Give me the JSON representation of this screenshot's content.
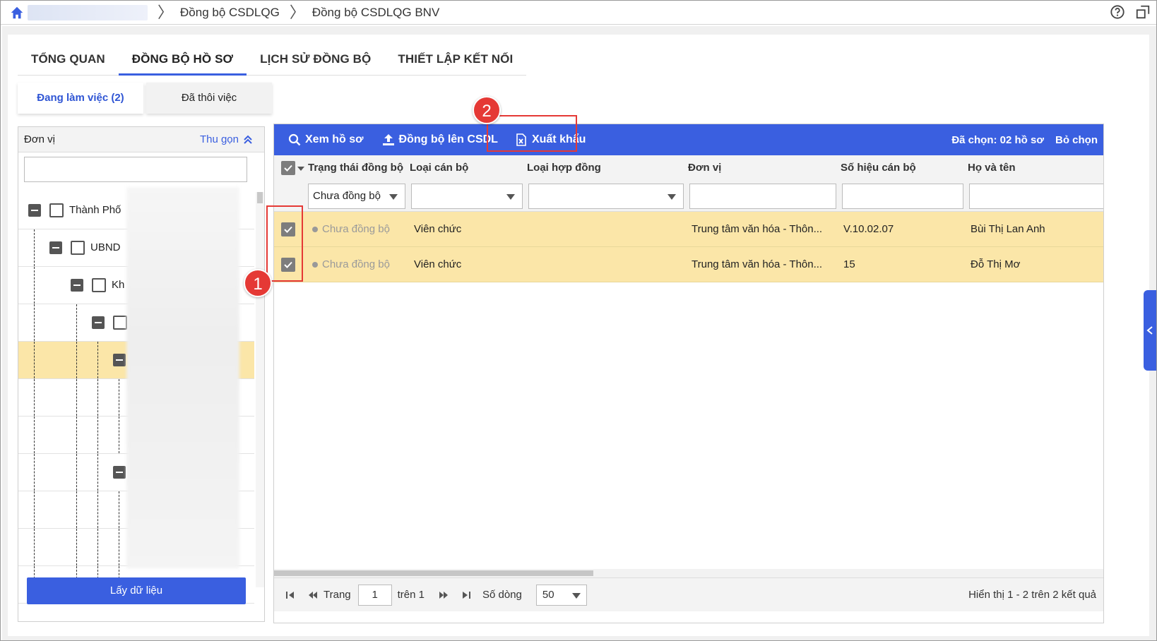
{
  "breadcrumb": [
    "Đồng bộ CSDLQG",
    "Đồng bộ CSDLQG BNV"
  ],
  "tabs": [
    "TỔNG QUAN",
    "ĐỒNG BỘ HỒ SƠ",
    "LỊCH SỬ ĐỒNG BỘ",
    "THIẾT LẬP KẾT NỐI"
  ],
  "subtabs": [
    "Đang làm việc (2)",
    "Đã thôi việc"
  ],
  "left_panel": {
    "title": "Đơn vị",
    "collapse_label": "Thu gọn",
    "tree_labels": [
      "Thành Phố",
      "UBND",
      "Kh"
    ],
    "get_data_button": "Lấy dữ liệu"
  },
  "toolbar": {
    "view_button": "Xem hồ sơ",
    "sync_button": "Đồng bộ lên CSDL",
    "export_button": "Xuất khẩu",
    "selected_text": "Đã chọn: 02 hồ sơ",
    "deselect_button": "Bỏ chọn"
  },
  "annotations": [
    "1",
    "2"
  ],
  "columns": [
    "Trạng thái đồng bộ",
    "Loại cán bộ",
    "Loại hợp đồng",
    "Đơn vị",
    "Số hiệu cán bộ",
    "Họ và tên"
  ],
  "filters": {
    "status": "Chưa đồng bộ"
  },
  "rows": [
    {
      "status": "Chưa đồng bộ",
      "staff_type": "Viên chức",
      "contract_type": "",
      "unit": "Trung tâm văn hóa - Thôn...",
      "staff_code": "V.10.02.07",
      "name": "Bùi Thị Lan Anh"
    },
    {
      "status": "Chưa đồng bộ",
      "staff_type": "Viên chức",
      "contract_type": "",
      "unit": "Trung tâm văn hóa - Thôn...",
      "staff_code": "15",
      "name": "Đỗ Thị Mơ"
    }
  ],
  "pager": {
    "page_label": "Trang",
    "page_value": "1",
    "of_label": "trên 1",
    "rows_label": "Số dòng",
    "rows_value": "50",
    "summary": "Hiển thị 1 - 2 trên 2 kết quả"
  },
  "colors": {
    "accent": "#3a5fe0",
    "selected_row": "#fbe6a8",
    "annotation": "#e53935"
  },
  "icons": [
    "home-icon",
    "help-icon",
    "popout-icon",
    "search-icon",
    "upload-icon",
    "excel-icon",
    "chevron-up-icon",
    "caret-down-icon",
    "first-page-icon",
    "prev-page-icon",
    "next-page-icon",
    "last-page-icon",
    "chevron-left-icon"
  ]
}
